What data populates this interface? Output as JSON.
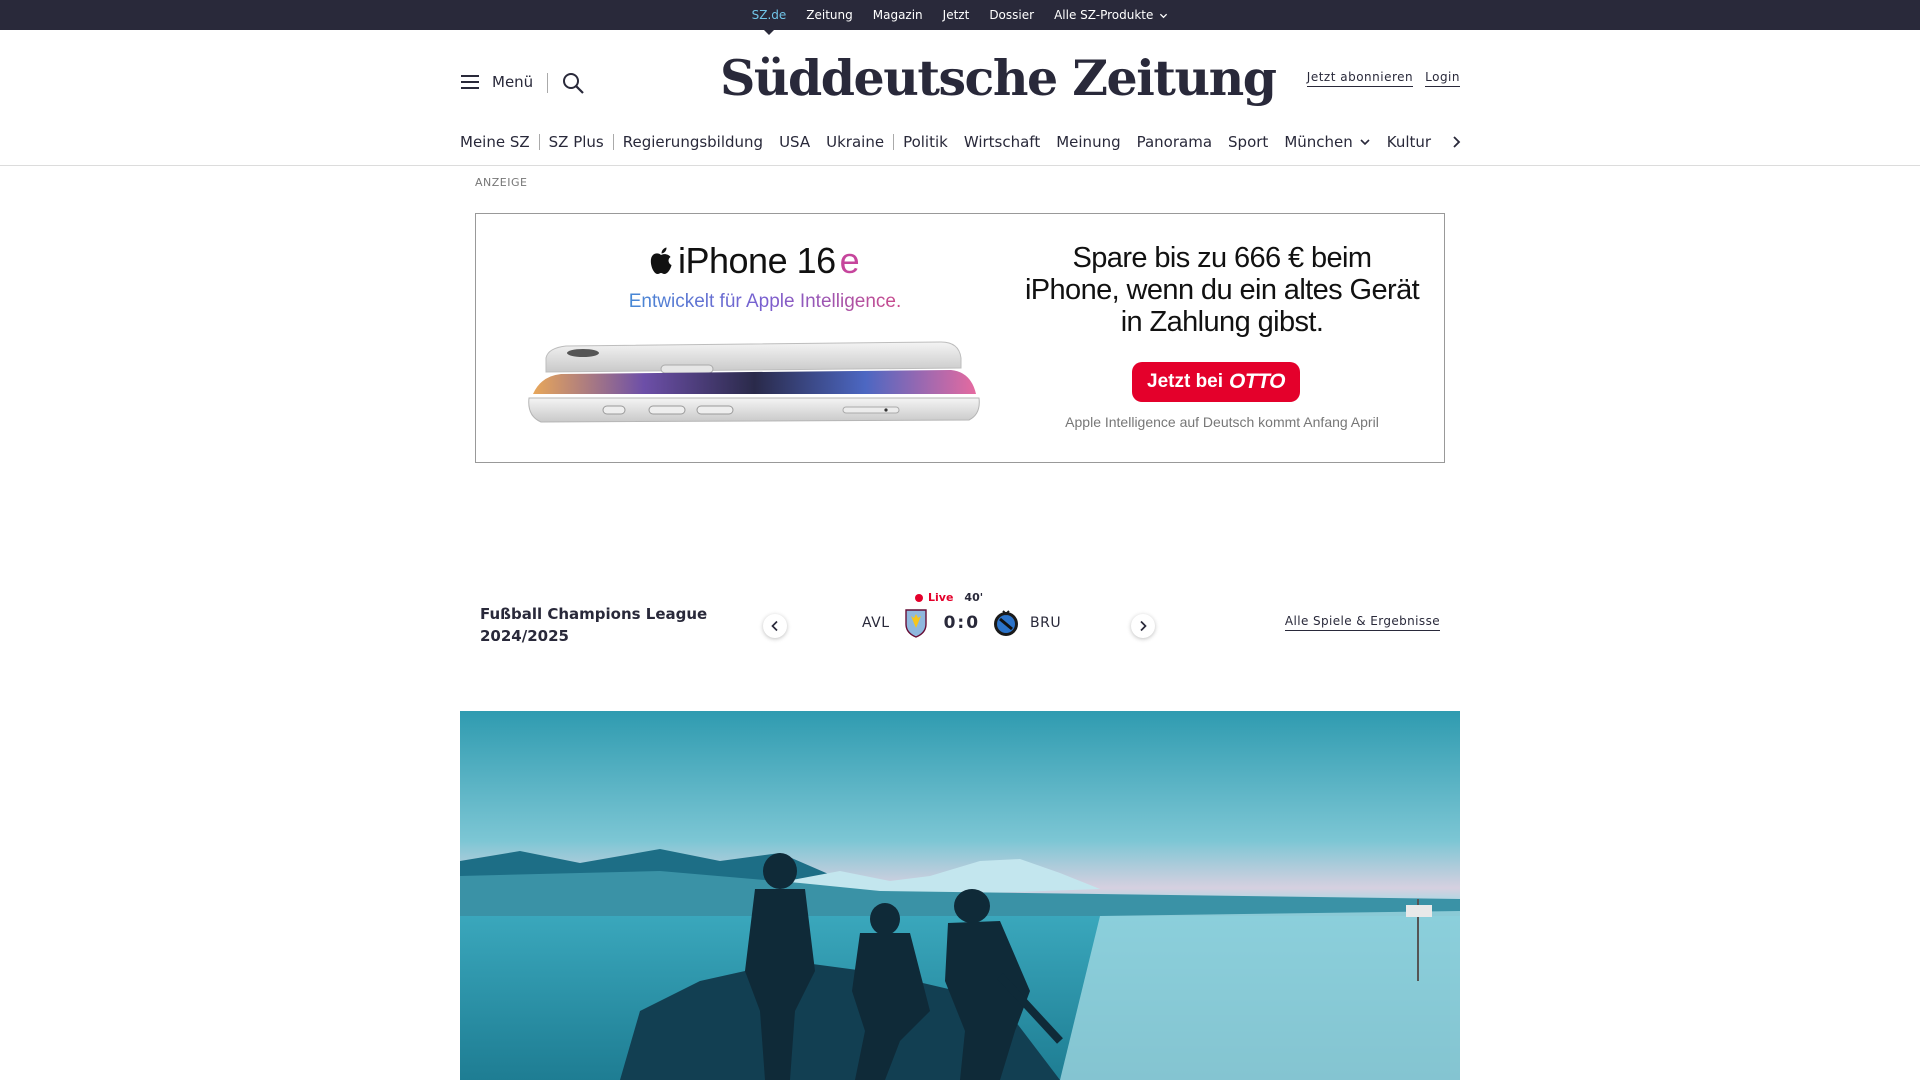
{
  "topbar": {
    "links": [
      "SZ.de",
      "Zeitung",
      "Magazin",
      "Jetzt",
      "Dossier",
      "Alle SZ-Produkte"
    ],
    "active_color": "#71c5e8",
    "background": "#29293a"
  },
  "header": {
    "menu_label": "Menü",
    "logo_text": "Süddeutsche Zeitung",
    "subscribe_label": "Jetzt abonnieren",
    "login_label": "Login"
  },
  "nav": {
    "items": [
      "Meine SZ",
      "SZ Plus",
      "Regierungsbildung",
      "USA",
      "Ukraine",
      "Politik",
      "Wirtschaft",
      "Meinung",
      "Panorama",
      "Sport",
      "München",
      "Kultur"
    ]
  },
  "ad": {
    "label": "ANZEIGE",
    "product": "iPhone 16",
    "product_suffix": "e",
    "subtitle": "Entwickelt für Apple Intelligence.",
    "headline": "Spare bis zu 666 € beim iPhone, wenn du ein altes Gerät in Zahlung gibst.",
    "cta_prefix": "Jetzt bei",
    "cta_brand": "OTTO",
    "footnote": "Apple Intelligence auf Deutsch kommt Anfang April",
    "cta_color": "#e4002b"
  },
  "scores": {
    "league": "Fußball Champions League 2024/2025",
    "status": "Live",
    "minute": "40'",
    "home_team": "AVL",
    "away_team": "BRU",
    "score": "0:0",
    "all_games_label": "Alle Spiele & Ergebnisse"
  }
}
